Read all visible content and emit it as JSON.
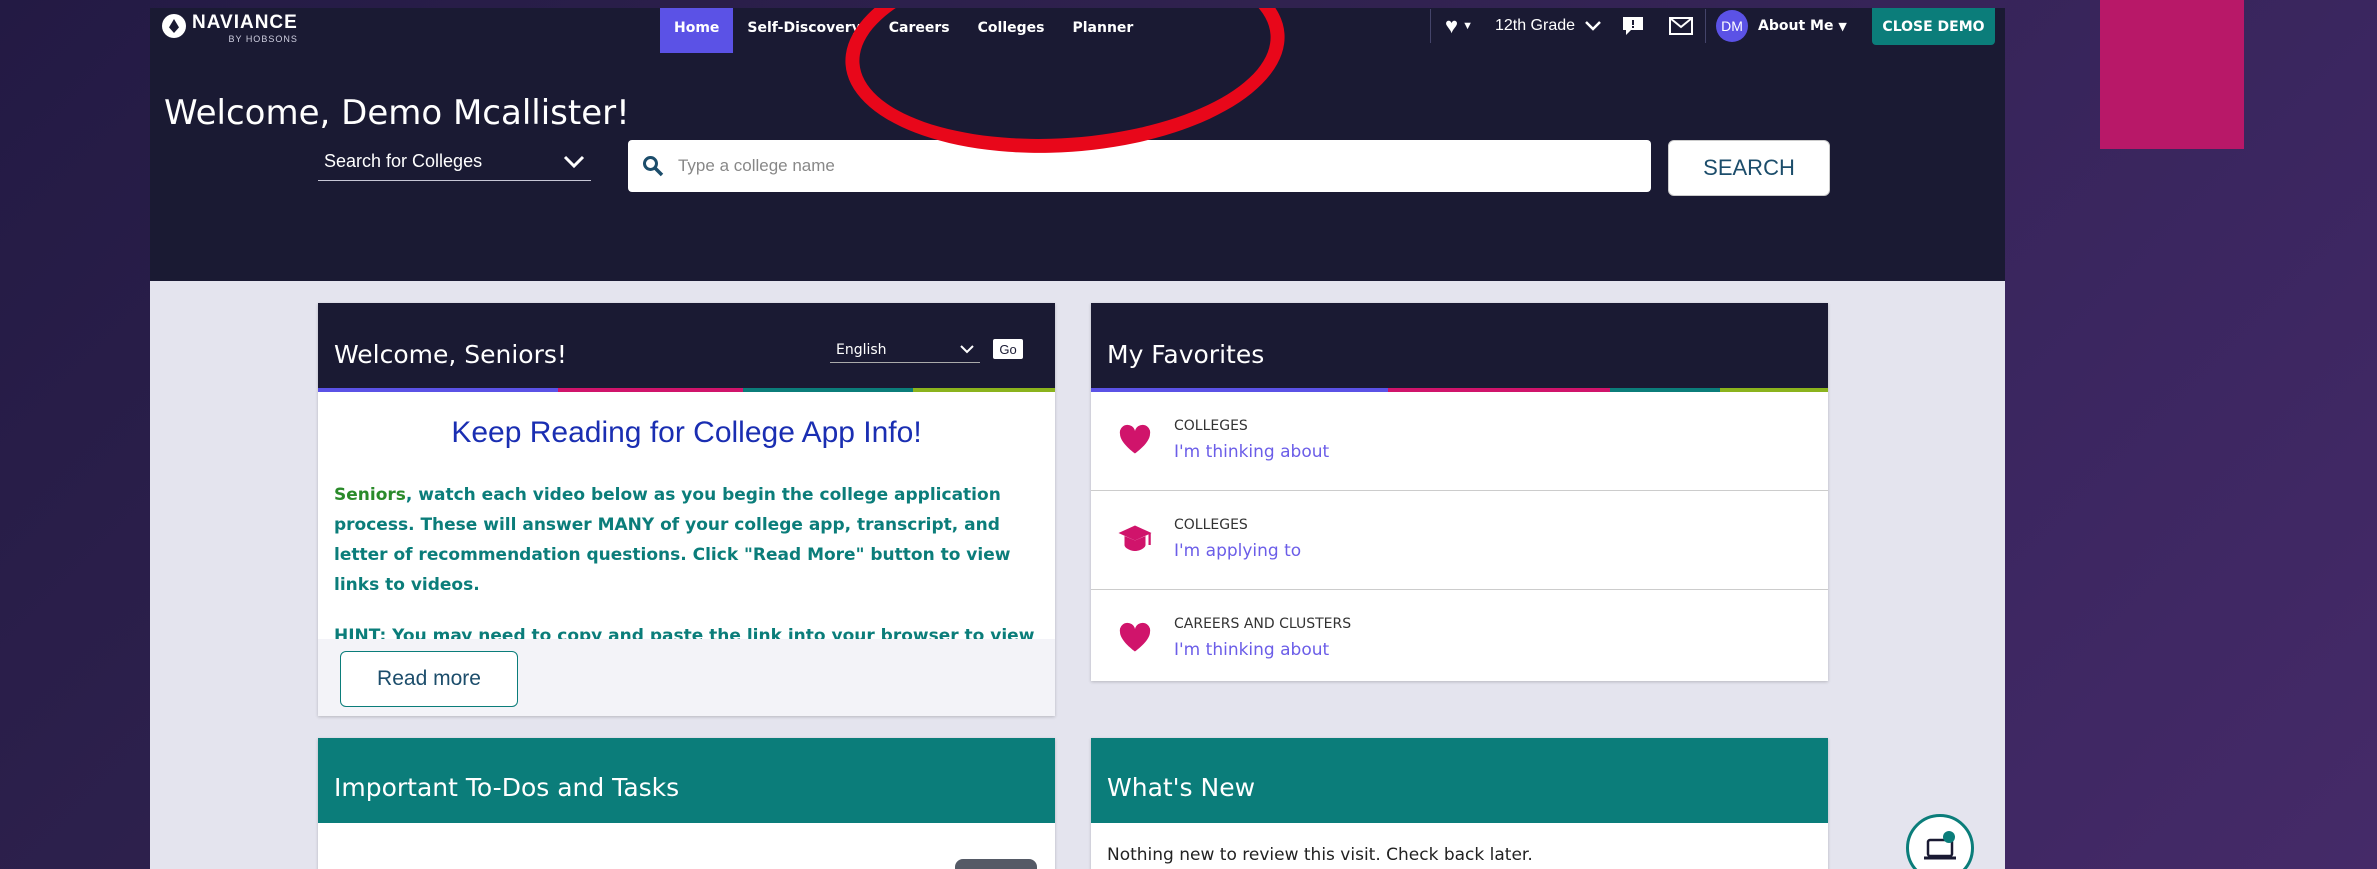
{
  "brand": {
    "name": "NAVIANCE",
    "sub": "BY HOBSONS"
  },
  "nav": {
    "items": [
      {
        "label": "Home",
        "active": true
      },
      {
        "label": "Self-Discovery",
        "active": false
      },
      {
        "label": "Careers",
        "active": false
      },
      {
        "label": "Colleges",
        "active": false
      },
      {
        "label": "Planner",
        "active": false
      }
    ],
    "grade": "12th Grade",
    "avatar_initials": "DM",
    "about_me": "About Me",
    "close_demo": "CLOSE DEMO"
  },
  "hero": {
    "welcome": "Welcome, Demo Mcallister!",
    "search_type": "Search for Colleges",
    "search_placeholder": "Type a college name",
    "search_button": "SEARCH"
  },
  "seniors_card": {
    "title": "Welcome, Seniors!",
    "language": "English",
    "go": "Go",
    "headline": "Keep Reading for College App Info!",
    "body_first": "Seniors",
    "body_rest": ", watch each video below as you begin the college application process. These will answer MANY of your college app, transcript, and letter of recommendation questions. Click \"Read More\" button to view links to videos.",
    "hint": "HINT: You may need to copy and paste the link into your browser to view the videos.",
    "read_more": "Read more"
  },
  "favorites_card": {
    "title": "My Favorites",
    "rows": [
      {
        "category": "COLLEGES",
        "link": "I'm thinking about",
        "icon": "heart-icon"
      },
      {
        "category": "COLLEGES",
        "link": "I'm applying to",
        "icon": "graduation-cap-icon"
      },
      {
        "category": "CAREERS AND CLUSTERS",
        "link": "I'm thinking about",
        "icon": "heart-icon"
      }
    ]
  },
  "todos_card": {
    "title": "Important To-Dos and Tasks"
  },
  "whatsnew_card": {
    "title": "What's New",
    "text": "Nothing new to review this visit. Check back later."
  },
  "colors": {
    "navy": "#1a1a33",
    "teal": "#0b7d7a",
    "accent_purple": "#5b52e6",
    "pink": "#d0146b",
    "annotation_red": "#e8071a",
    "stripe": [
      "#5b52e6",
      "#d0146b",
      "#0b7d7a",
      "#8bb31d"
    ]
  }
}
